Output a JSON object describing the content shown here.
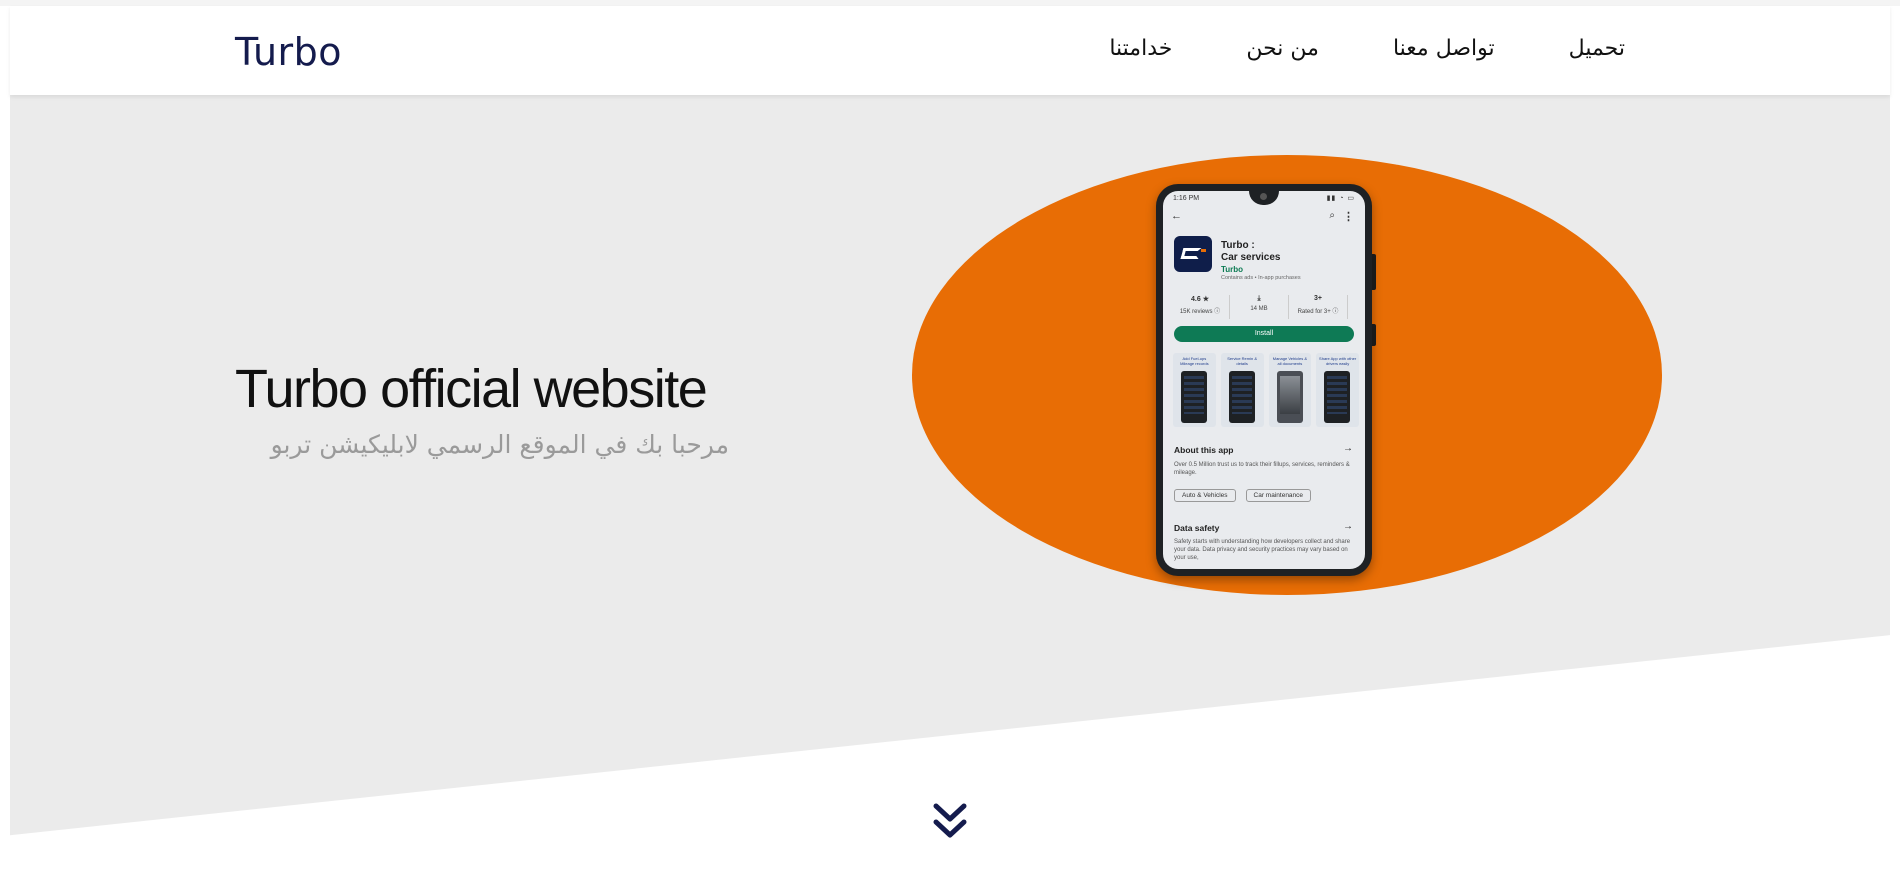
{
  "brand": {
    "logo": "Turbo",
    "color": "#141b4d",
    "accent": "#e86d05"
  },
  "nav": {
    "items": [
      {
        "label": "تحميل"
      },
      {
        "label": "تواصل معنا"
      },
      {
        "label": "من نحن"
      },
      {
        "label": "خدامتنا"
      }
    ]
  },
  "hero": {
    "title": "Turbo official website",
    "subtitle": "مرحبا بك في الموقع الرسمي لابليكيشن تربو"
  },
  "phone_screen": {
    "status_time": "1:16 PM",
    "status_icons": "▮▮ ◔ ▭",
    "back": "←",
    "search": "⌕",
    "more": "⋮",
    "app_name": "Turbo :\nCar services",
    "developer": "Turbo",
    "contains": "Contains ads • In-app purchases",
    "stats": [
      {
        "value": "4.6 ★",
        "label": "15K reviews ⓘ"
      },
      {
        "value": "⤓",
        "label": "14 MB"
      },
      {
        "value": "3+",
        "label": "Rated for 3+ ⓘ"
      }
    ],
    "install_label": "Install",
    "screenshot_captions": [
      "Add Fuel-ups Mileage records",
      "Service Remin & details",
      "Manage Vehicles & all documents",
      "Share App with other drivers easily"
    ],
    "about_title": "About this app",
    "about_text": "Over 0.5 Million trust us to track their fillups, services, reminders & mileage.",
    "chips": [
      "Auto & Vehicles",
      "Car maintenance"
    ],
    "safety_title": "Data safety",
    "safety_text": "Safety starts with understanding how developers collect and share your data. Data privacy and security practices may vary based on your use,",
    "arrow": "→"
  },
  "scroll_icon": "double-chevron-down-icon"
}
